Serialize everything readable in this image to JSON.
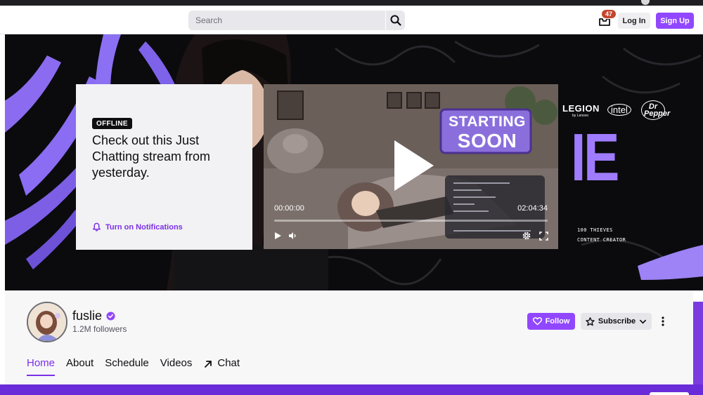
{
  "header": {
    "search_placeholder": "Search",
    "inbox_count": "47",
    "login_label": "Log In",
    "signup_label": "Sign Up"
  },
  "banner": {
    "sponsors": [
      "LEGION",
      "by Lenovo",
      "intel",
      "Dr Pepper"
    ],
    "big_text": "IE",
    "tagline_line1": "100 THIEVES",
    "tagline_line2": "CONTENT CREATOR"
  },
  "offline_card": {
    "badge": "OFFLINE",
    "message": "Check out this Just Chatting stream from yesterday.",
    "notification_label": "Turn on Notifications"
  },
  "player": {
    "overlay_line1": "STARTING",
    "overlay_line2": "SOON",
    "time_current": "00:00:00",
    "time_total": "02:04:34",
    "progress": 0
  },
  "channel": {
    "name": "fuslie",
    "followers": "1.2M followers",
    "follow_label": "Follow",
    "subscribe_label": "Subscribe",
    "tabs": [
      "Home",
      "About",
      "Schedule",
      "Videos",
      "Chat"
    ],
    "active_tab": "Home"
  },
  "colors": {
    "accent": "#9147ff",
    "accent_text": "#7b2fe8",
    "badge_red": "#c4442e"
  }
}
